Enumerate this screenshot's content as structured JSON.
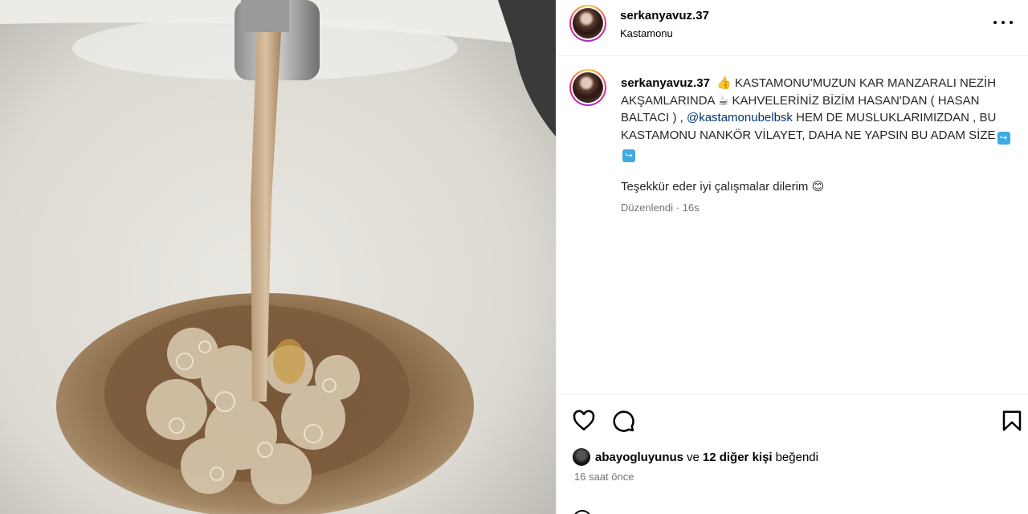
{
  "post": {
    "username": "serkanyavuz.37",
    "location": "Kastamonu",
    "caption": {
      "author": "serkanyavuz.37",
      "emoji_hand": "👍",
      "text_1": "KASTAMONU'MUZUN KAR MANZARALI NEZİH AKŞAMLARINDA",
      "emoji_coffee": "☕",
      "text_2": "KAHVELERİNİZ BİZİM HASAN'DAN ( HASAN BALTACI ) ,",
      "mention": "@kastamonubelbsk",
      "text_3": "HEM DE MUSLUKLARIMIZDAN , BU KASTAMONU NANKÖR VİLAYET, DAHA NE YAPSIN BU ADAM SİZE",
      "emoji_arrow": "↪",
      "thanks": "Teşekkür eder iyi çalışmalar dilerim",
      "emoji_smile": "😊",
      "edited": "Düzenlendi",
      "edited_ago": "16s"
    },
    "likes": {
      "liker": "abayogluyunus",
      "and": "ve",
      "others": "12 diğer kişi",
      "suffix": "beğendi"
    },
    "time_ago": "16 saat önce"
  },
  "icons": [
    "more-icon",
    "heart-icon",
    "comment-icon",
    "bookmark-icon"
  ]
}
